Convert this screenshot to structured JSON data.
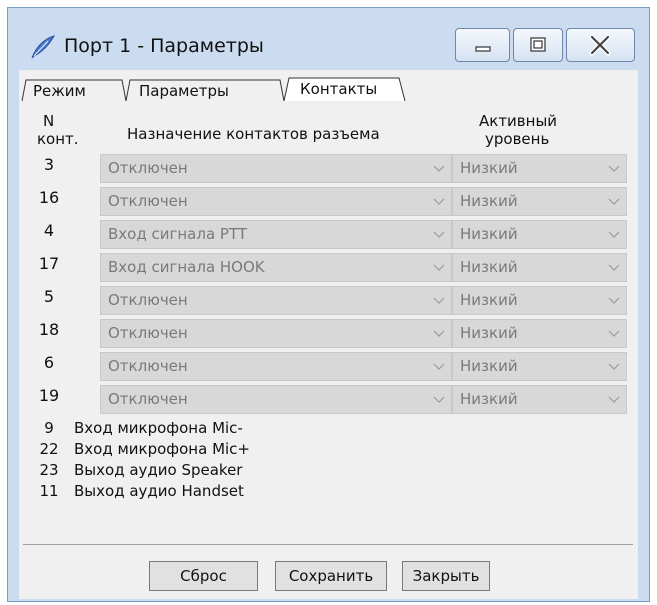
{
  "window": {
    "title": "Порт 1 - Параметры"
  },
  "tabs": [
    {
      "label": "Режим"
    },
    {
      "label": "Параметры"
    },
    {
      "label": "Контакты",
      "active": true
    }
  ],
  "headers": {
    "pin_n": "N",
    "pin_unit": "конт.",
    "assignment": "Назначение контактов разъема",
    "active_level_line1": "Активный",
    "active_level_line2": "уровень"
  },
  "rows": [
    {
      "pin": "3",
      "assignment": "Отключен",
      "level": "Низкий"
    },
    {
      "pin": "16",
      "assignment": "Отключен",
      "level": "Низкий"
    },
    {
      "pin": "4",
      "assignment": "Вход сигнала PTT",
      "level": "Низкий"
    },
    {
      "pin": "17",
      "assignment": "Вход сигнала HOOK",
      "level": "Низкий"
    },
    {
      "pin": "5",
      "assignment": "Отключен",
      "level": "Низкий"
    },
    {
      "pin": "18",
      "assignment": "Отключен",
      "level": "Низкий"
    },
    {
      "pin": "6",
      "assignment": "Отключен",
      "level": "Низкий"
    },
    {
      "pin": "19",
      "assignment": "Отключен",
      "level": "Низкий"
    }
  ],
  "fixed_rows": [
    {
      "pin": "9",
      "assignment": "Вход микрофона Mic-"
    },
    {
      "pin": "22",
      "assignment": "Вход микрофона Mic+"
    },
    {
      "pin": "23",
      "assignment": "Выход аудио Speaker"
    },
    {
      "pin": "11",
      "assignment": "Выход аудио Handset"
    }
  ],
  "buttons": {
    "reset": "Сброс",
    "save": "Сохранить",
    "close": "Закрыть"
  },
  "icons": {
    "app": "feather-icon",
    "minimize": "minimize-icon",
    "maximize": "maximize-icon",
    "close": "close-icon",
    "dropdown": "chevron-down-icon"
  },
  "colors": {
    "window_frame": "#cbdcf0",
    "content_bg": "#f0f0f0",
    "disabled_combo": "#d8d8d8",
    "disabled_text": "#7a7a7a"
  }
}
